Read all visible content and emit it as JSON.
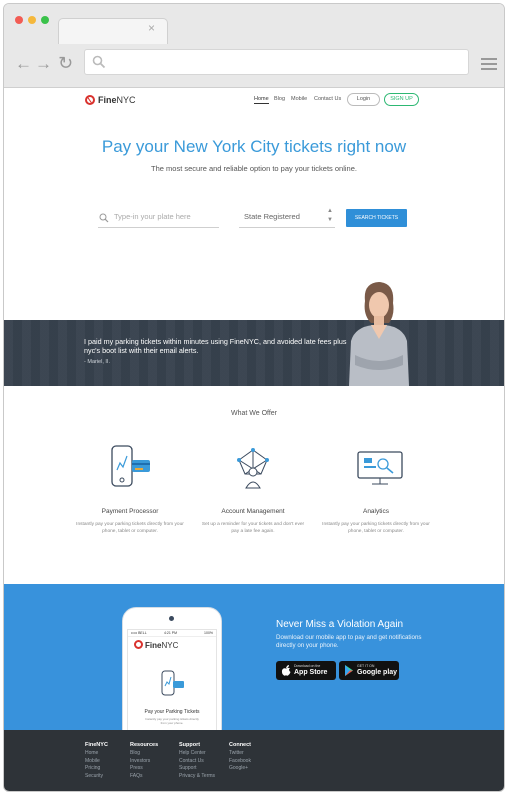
{
  "browser": {
    "tab_close": "×"
  },
  "header": {
    "logo_fine": "Fine",
    "logo_nyc": "NYC",
    "nav": [
      "Home",
      "Blog",
      "Mobile",
      "Contact Us"
    ],
    "login": "Login",
    "signup": "SIGN UP"
  },
  "hero": {
    "title": "Pay your New York City tickets right now",
    "subtitle": "The most secure and reliable option to pay your tickets online.",
    "plate_placeholder": "Type-in your plate here",
    "state_select": "State Registered",
    "search_button": "SEARCH TICKETS"
  },
  "testimonial": {
    "quote": "I paid my parking tickets within minutes using FineNYC, and avoided late fees plus nyc's boot list with their email alerts.",
    "author": "- Mariel, II."
  },
  "offer": {
    "title": "What We Offer",
    "features": [
      {
        "title": "Payment Processor",
        "desc": "Instantly pay your parking tickets directly from your phone, tablet or computer."
      },
      {
        "title": "Account Management",
        "desc": "Set up a reminder for your tickets and don't ever pay a late fee again."
      },
      {
        "title": "Analytics",
        "desc": "Instantly pay your parking tickets directly from your phone, tablet or computer."
      }
    ]
  },
  "app": {
    "title": "Never Miss a Violation Again",
    "subtitle": "Download our mobile app to pay and get notifications directly on your phone.",
    "appstore_small": "Download on the",
    "appstore_big": "App Store",
    "google_small": "GET IT ON",
    "google_big": "Google play",
    "phone_time": "4:21 PM",
    "phone_status": "••••• BELL",
    "phone_battery": "100%",
    "phone_logo_fine": "Fine",
    "phone_logo_nyc": "NYC",
    "phone_title": "Pay your Parking Tickets",
    "phone_desc": "Instantly pay your parking tickets directly from your phone."
  },
  "footer": {
    "columns": [
      {
        "heading": "FineNYC",
        "items": [
          "Home",
          "Mobile",
          "Pricing",
          "Security"
        ]
      },
      {
        "heading": "Resources",
        "items": [
          "Blog",
          "Investors",
          "Press",
          "FAQs"
        ]
      },
      {
        "heading": "Support",
        "items": [
          "Help Center",
          "Contact Us",
          "Support",
          "Privacy & Terms"
        ]
      },
      {
        "heading": "Connect",
        "items": [
          "Twitter",
          "Facebook",
          "Google+"
        ]
      }
    ]
  },
  "colors": {
    "accent": "#3a9ad9",
    "button": "#2f8fd8",
    "green": "#2db873",
    "brand_red": "#d9322e",
    "footer": "#2e3338"
  }
}
